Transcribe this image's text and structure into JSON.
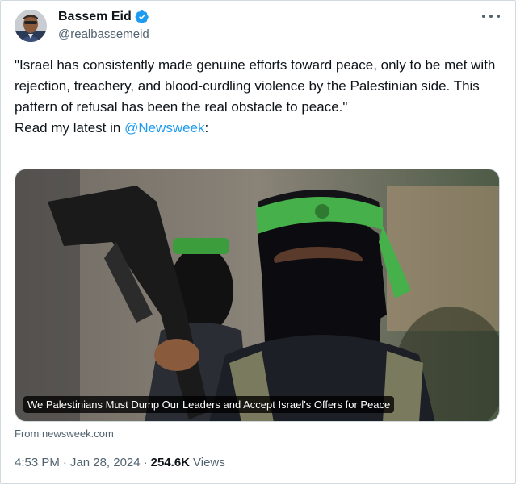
{
  "author": {
    "name": "Bassem Eid",
    "handle": "@realbassemeid",
    "verified": true,
    "avatar_icon": "profile-photo"
  },
  "tweet": {
    "text_main": "\"Israel has consistently made genuine efforts toward peace, only to be met with rejection, treachery, and blood-curdling violence by the Palestinian side. This pattern of refusal has been the real obstacle to peace.\"",
    "text_prefix": "Read my latest in ",
    "mention": "@Newsweek",
    "text_suffix": ":"
  },
  "card": {
    "headline": "We Palestinians Must Dump Our Leaders and Accept Israel's Offers for Peace",
    "source": "From newsweek.com"
  },
  "meta": {
    "time": "4:53 PM",
    "separator": "·",
    "date": "Jan 28, 2024",
    "separator2": "·",
    "views_count": "254.6K",
    "views_label": "Views"
  },
  "colors": {
    "accent": "#1d9bf0",
    "text": "#0f1419",
    "secondary": "#536471",
    "border": "#cfd9de"
  }
}
